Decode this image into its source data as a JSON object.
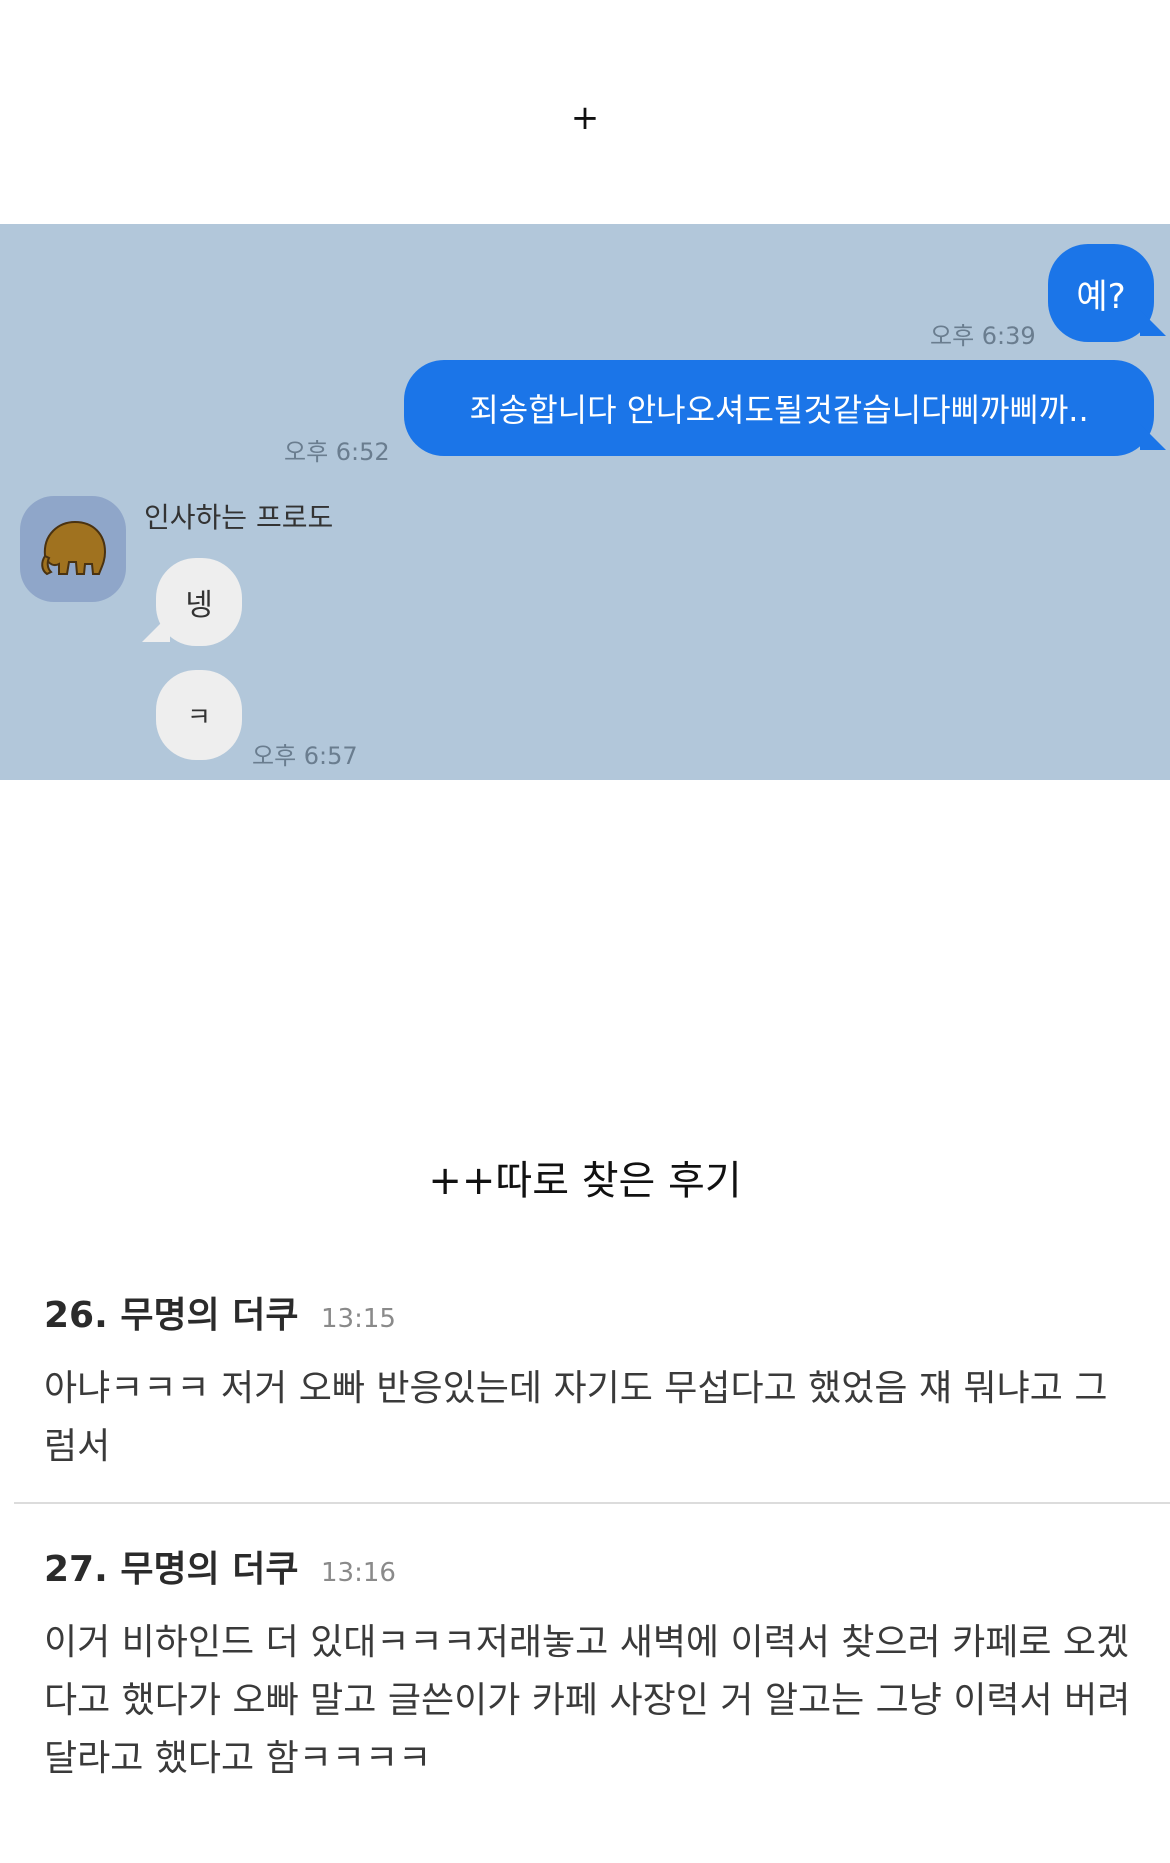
{
  "top_marker": "+",
  "chat": {
    "messages_out": [
      {
        "text": "예?",
        "time": "오후 6:39"
      },
      {
        "text": "죄송합니다 안나오셔도될것같습니다삐까삐까..",
        "time": "오후 6:52"
      }
    ],
    "sender_name": "인사하는 프로도",
    "messages_in": [
      {
        "text": "넹"
      },
      {
        "text": "ㅋ",
        "time": "오후 6:57"
      }
    ]
  },
  "review_title": "++따로 찾은 후기",
  "comments": [
    {
      "number": "26.",
      "author": "무명의 더쿠",
      "time": "13:15",
      "text": "아냐ㅋㅋㅋ 저거 오빠 반응있는데 자기도 무섭다고 했었음 쟤 뭐냐고 그럼서"
    },
    {
      "number": "27.",
      "author": "무명의 더쿠",
      "time": "13:16",
      "text": "이거 비하인드 더 있대ㅋㅋㅋ저래놓고 새벽에 이력서 찾으러 카페로 오겠다고 했다가 오빠 말고 글쓴이가 카페 사장인 거 알고는 그냥 이력서 버려달라고 했다고 함ㅋㅋㅋㅋ"
    }
  ]
}
